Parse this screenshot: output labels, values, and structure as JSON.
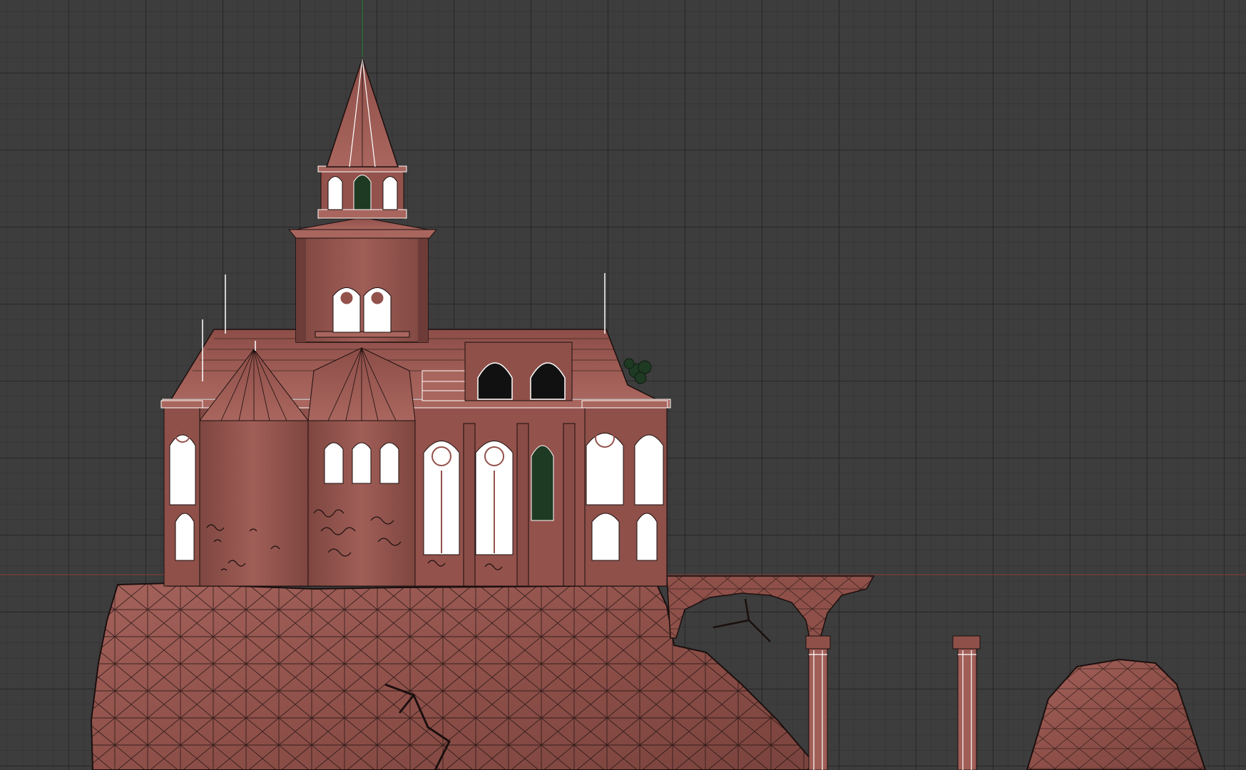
{
  "viewport": {
    "kind": "3d-modeling-orthographic-viewport",
    "view": "front",
    "shading": "solid-with-wireframe",
    "model": "castle-on-cliff",
    "colors": {
      "background": "#3d3d3d",
      "grid_major": "#2a2a2a",
      "grid_minor": "#353535",
      "model_base": "#9c5a54",
      "model_shadow": "#6e3c38",
      "wire": "#1b0f0e",
      "window_outline": "#ffffff",
      "foliage": "#1f3a23",
      "axis_x": "#8a3a3a",
      "axis_z": "#2e6b34"
    }
  }
}
